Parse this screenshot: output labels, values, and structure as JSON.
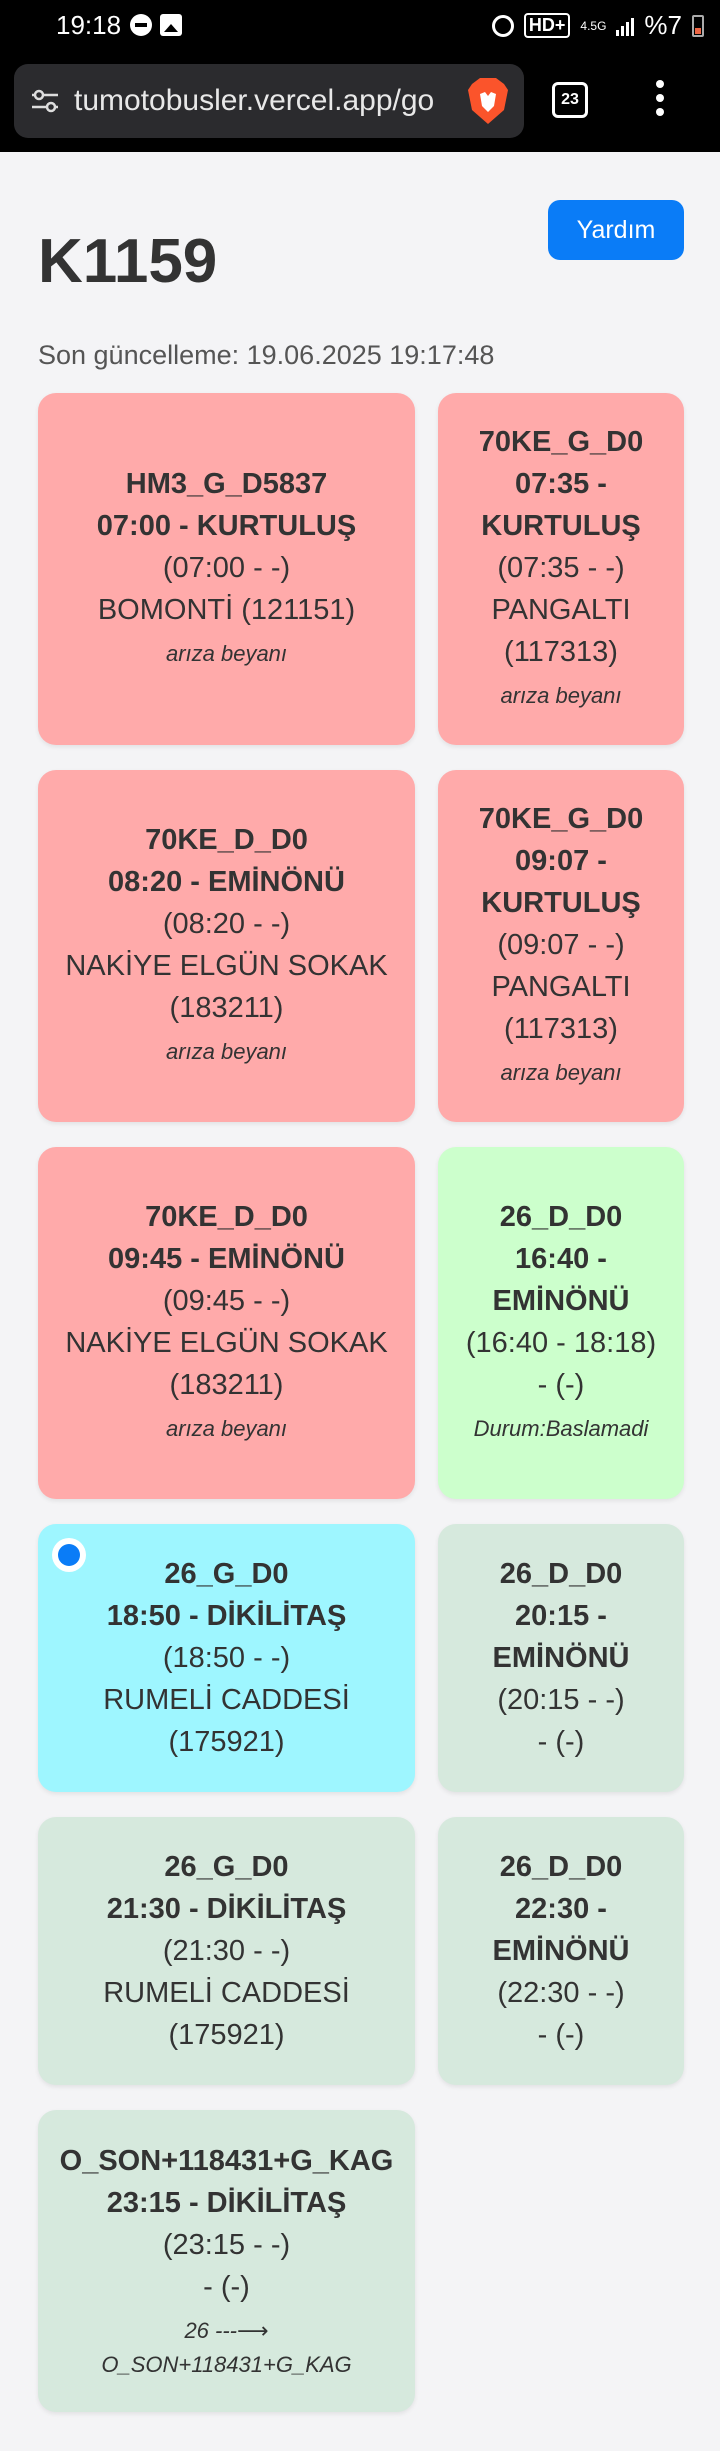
{
  "status_bar": {
    "time": "19:18",
    "network": "4.5G",
    "hd": "HD+",
    "battery": "%7"
  },
  "browser": {
    "url": "tumotobusler.vercel.app/go",
    "tab_count": "23"
  },
  "page": {
    "title": "K1159",
    "help_label": "Yardım",
    "last_update": "Son güncelleme: 19.06.2025 19:17:48"
  },
  "cards": [
    {
      "code": "HM3_G_D5837",
      "time_dest": "07:00 - KURTULUŞ",
      "times": "(07:00 - -)",
      "stop": "BOMONTİ (121151)",
      "note": "arıza beyanı",
      "color": "red"
    },
    {
      "code": "70KE_G_D0",
      "time_dest": "07:35 - KURTULUŞ",
      "times": "(07:35 - -)",
      "stop": "PANGALTI (117313)",
      "note": "arıza beyanı",
      "color": "red"
    },
    {
      "code": "70KE_D_D0",
      "time_dest": "08:20 - EMİNÖNÜ",
      "times": "(08:20 - -)",
      "stop": "NAKİYE ELGÜN SOKAK (183211)",
      "note": "arıza beyanı",
      "color": "red"
    },
    {
      "code": "70KE_G_D0",
      "time_dest": "09:07 - KURTULUŞ",
      "times": "(09:07 - -)",
      "stop": "PANGALTI (117313)",
      "note": "arıza beyanı",
      "color": "red"
    },
    {
      "code": "70KE_D_D0",
      "time_dest": "09:45 - EMİNÖNÜ",
      "times": "(09:45 - -)",
      "stop": "NAKİYE ELGÜN SOKAK (183211)",
      "note": "arıza beyanı",
      "color": "red"
    },
    {
      "code": "26_D_D0",
      "time_dest": "16:40 - EMİNÖNÜ",
      "times": "(16:40 - 18:18)",
      "stop": "- (-)",
      "note": "Durum:Baslamadi",
      "color": "green-bright"
    },
    {
      "code": "26_G_D0",
      "time_dest": "18:50 - DİKİLİTAŞ",
      "times": "(18:50 - -)",
      "stop": "RUMELİ CADDESİ (175921)",
      "note": "",
      "color": "cyan"
    },
    {
      "code": "26_D_D0",
      "time_dest": "20:15 - EMİNÖNÜ",
      "times": "(20:15 - -)",
      "stop": "- (-)",
      "note": "",
      "color": "grey-green"
    },
    {
      "code": "26_G_D0",
      "time_dest": "21:30 - DİKİLİTAŞ",
      "times": "(21:30 - -)",
      "stop": "RUMELİ CADDESİ (175921)",
      "note": "",
      "color": "grey-green"
    },
    {
      "code": "26_D_D0",
      "time_dest": "22:30 - EMİNÖNÜ",
      "times": "(22:30 - -)",
      "stop": "- (-)",
      "note": "",
      "color": "grey-green"
    },
    {
      "code": "O_SON+118431+G_KAG",
      "time_dest": "23:15 - DİKİLİTAŞ",
      "times": "(23:15 - -)",
      "stop": "- (-)",
      "note": "26 ---⟶",
      "note2": "O_SON+118431+G_KAG",
      "color": "grey-green"
    }
  ]
}
